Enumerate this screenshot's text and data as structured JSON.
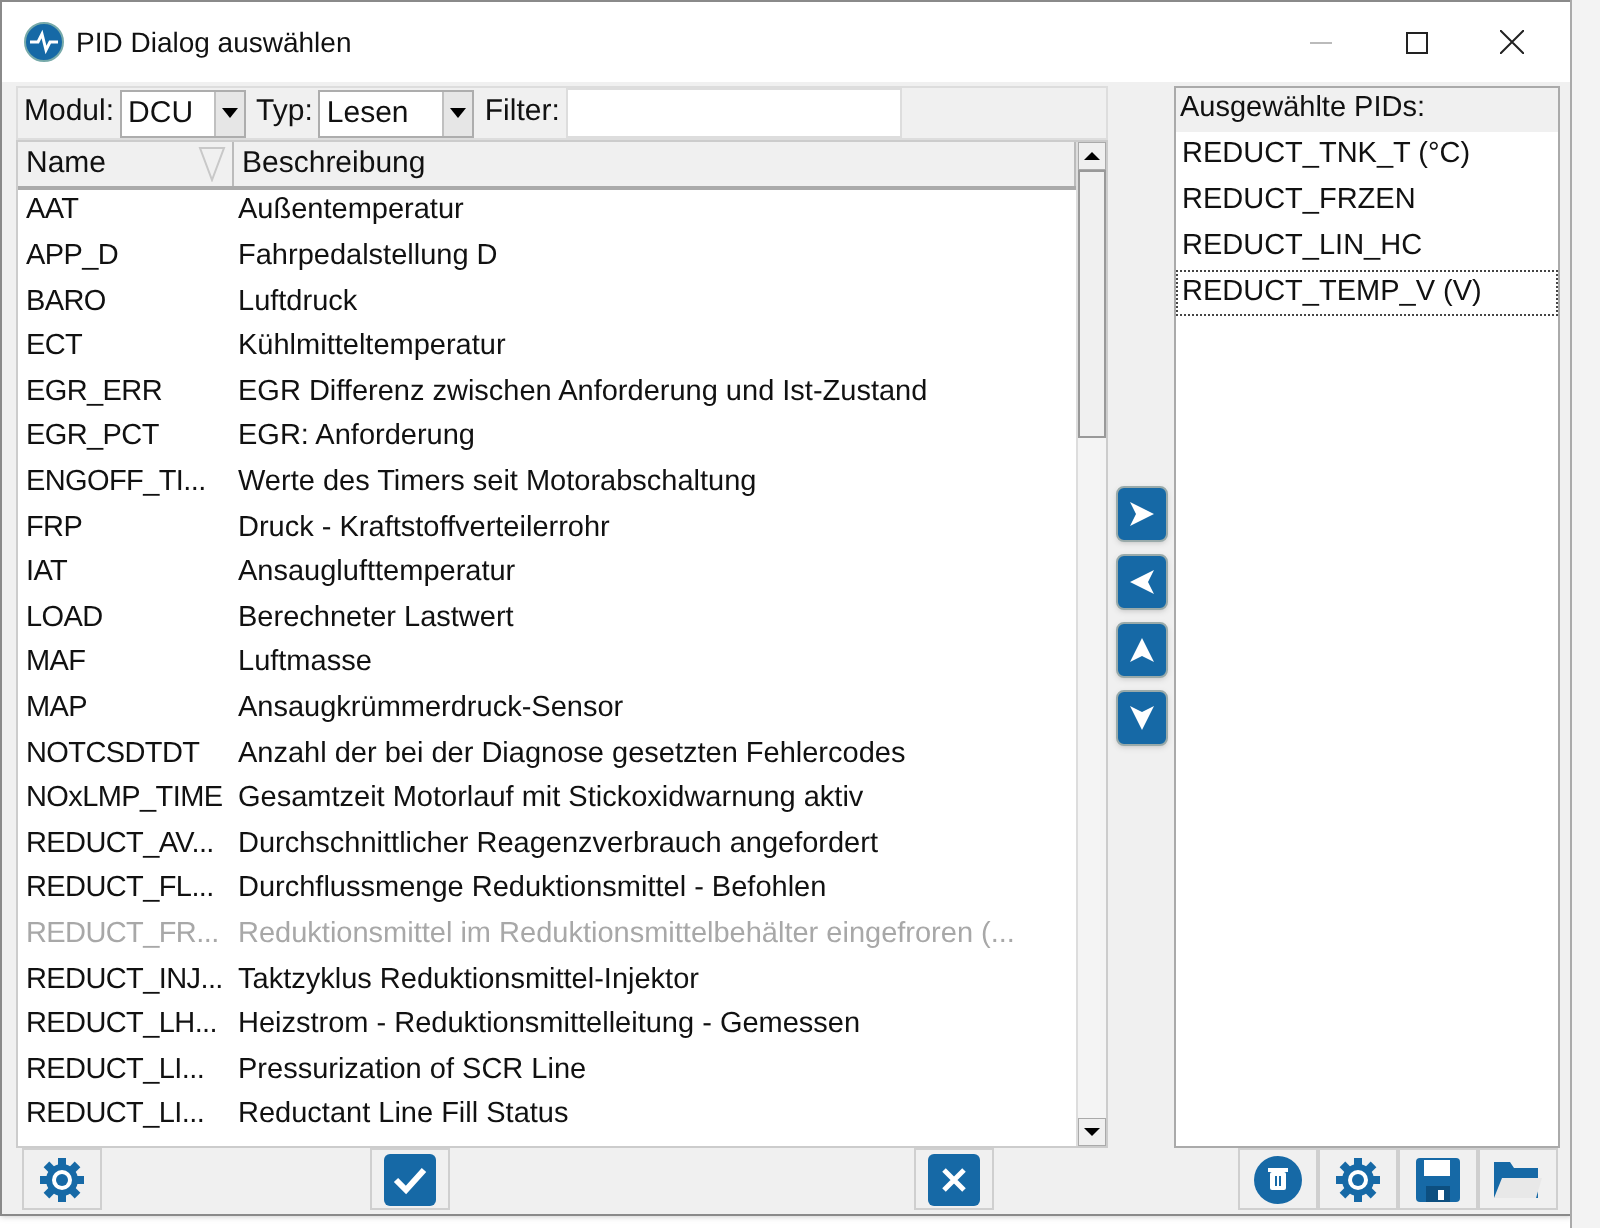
{
  "window": {
    "title": "PID Dialog auswählen"
  },
  "filters": {
    "module_label": "Modul:",
    "module_value": "DCU",
    "type_label": "Typ:",
    "type_value": "Lesen",
    "filter_label": "Filter:"
  },
  "table": {
    "columns": [
      {
        "label": "Name",
        "sorted": true
      },
      {
        "label": "Beschreibung",
        "sorted": false
      }
    ],
    "rows": [
      {
        "name": "AAT",
        "description": "Außentemperatur",
        "disabled": false
      },
      {
        "name": "APP_D",
        "description": "Fahrpedalstellung D",
        "disabled": false
      },
      {
        "name": "BARO",
        "description": "Luftdruck",
        "disabled": false
      },
      {
        "name": "ECT",
        "description": "Kühlmitteltemperatur",
        "disabled": false
      },
      {
        "name": "EGR_ERR",
        "description": "EGR Differenz zwischen Anforderung und Ist-Zustand",
        "disabled": false
      },
      {
        "name": "EGR_PCT",
        "description": "EGR: Anforderung",
        "disabled": false
      },
      {
        "name": "ENGOFF_TI...",
        "description": "Werte des Timers seit Motorabschaltung",
        "disabled": false
      },
      {
        "name": "FRP",
        "description": "Druck - Kraftstoffverteilerrohr",
        "disabled": false
      },
      {
        "name": "IAT",
        "description": "Ansauglufttemperatur",
        "disabled": false
      },
      {
        "name": "LOAD",
        "description": "Berechneter Lastwert",
        "disabled": false
      },
      {
        "name": "MAF",
        "description": "Luftmasse",
        "disabled": false
      },
      {
        "name": "MAP",
        "description": "Ansaugkrümmerdruck-Sensor",
        "disabled": false
      },
      {
        "name": "NOTCSDTDT",
        "description": "Anzahl der bei der Diagnose gesetzten Fehlercodes",
        "disabled": false
      },
      {
        "name": "NOxLMP_TIME",
        "description": "Gesamtzeit Motorlauf mit Stickoxidwarnung aktiv",
        "disabled": false
      },
      {
        "name": "REDUCT_AV...",
        "description": "Durchschnittlicher Reagenzverbrauch angefordert",
        "disabled": false
      },
      {
        "name": "REDUCT_FL...",
        "description": "Durchflussmenge Reduktionsmittel - Befohlen",
        "disabled": false
      },
      {
        "name": "REDUCT_FR...",
        "description": "Reduktionsmittel im Reduktionsmittelbehälter eingefroren (...",
        "disabled": true
      },
      {
        "name": "REDUCT_INJ...",
        "description": "Taktzyklus Reduktionsmittel-Injektor",
        "disabled": false
      },
      {
        "name": "REDUCT_LH...",
        "description": "Heizstrom - Reduktionsmittelleitung - Gemessen",
        "disabled": false
      },
      {
        "name": "REDUCT_LI...",
        "description": "Pressurization of SCR Line",
        "disabled": false
      },
      {
        "name": "REDUCT_LI...",
        "description": "Reductant Line Fill Status",
        "disabled": false
      }
    ]
  },
  "selected_list": {
    "title": "Ausgewählte PIDs:",
    "items": [
      {
        "label": "REDUCT_TNK_T (°C)",
        "focused": false
      },
      {
        "label": "REDUCT_FRZEN",
        "focused": false
      },
      {
        "label": "REDUCT_LIN_HC",
        "focused": false
      },
      {
        "label": "REDUCT_TEMP_V (V)",
        "focused": true
      }
    ]
  },
  "move_buttons": [
    {
      "kind": "right"
    },
    {
      "kind": "left"
    },
    {
      "kind": "up"
    },
    {
      "kind": "down"
    }
  ],
  "bottom_left_buttons": [
    {
      "kind": "settings"
    },
    {
      "kind": "ok"
    },
    {
      "kind": "cancel"
    }
  ],
  "bottom_right_buttons": [
    {
      "kind": "delete"
    },
    {
      "kind": "settings"
    },
    {
      "kind": "save"
    },
    {
      "kind": "open"
    }
  ]
}
